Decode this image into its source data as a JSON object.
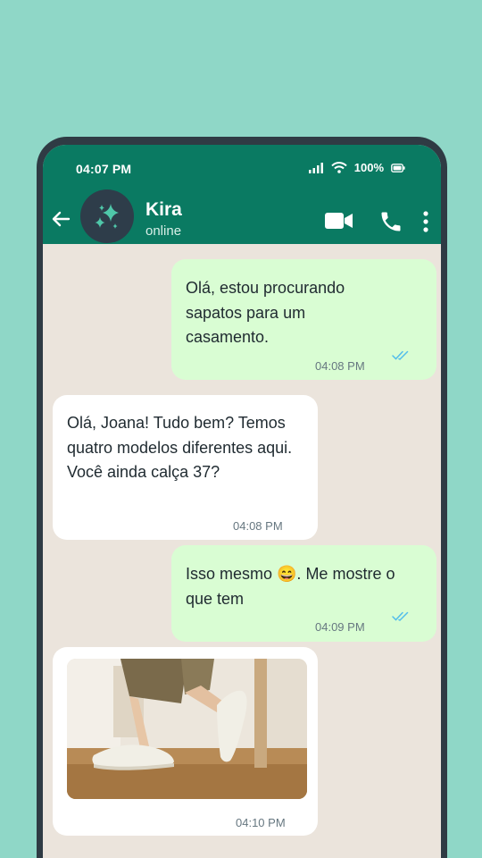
{
  "status": {
    "time": "04:07 PM",
    "battery": "100%"
  },
  "contact": {
    "name": "Kira",
    "presence": "online"
  },
  "messages": [
    {
      "direction": "out",
      "text": "Olá, estou procurando sapatos para um casamento.",
      "time": "04:08 PM",
      "read": true
    },
    {
      "direction": "in",
      "text": "Olá, Joana! Tudo bem? Temos quatro modelos diferentes aqui. Você ainda calça 37?",
      "time": "04:08 PM"
    },
    {
      "direction": "out",
      "text": "Isso mesmo 😄. Me mostre o que tem",
      "time": "04:09 PM",
      "read": true
    },
    {
      "direction": "in",
      "type": "image",
      "image_subject": "shoe-photo",
      "time": "04:10 PM"
    }
  ],
  "icons": [
    "back-arrow-icon",
    "sparkle-icon",
    "video-call-icon",
    "phone-call-icon",
    "more-options-icon",
    "signal-icon",
    "wifi-icon",
    "battery-icon",
    "double-check-icon"
  ],
  "colors": {
    "header": "#0a7a62",
    "outgoing_bubble": "#d9fdd3",
    "incoming_bubble": "#ffffff",
    "chat_bg": "#ebe4dc",
    "read_tick": "#53bdeb",
    "page_bg": "#8fd7c7"
  }
}
